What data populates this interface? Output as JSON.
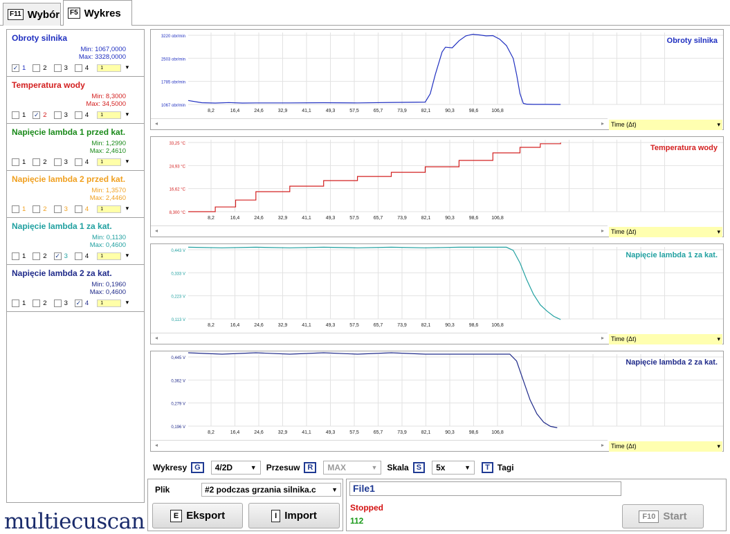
{
  "tabs": [
    {
      "key": "F11",
      "label": "Wybór",
      "active": false
    },
    {
      "key": "F5",
      "label": "Wykres",
      "active": true
    }
  ],
  "sensors": [
    {
      "name": "Obroty silnika",
      "min": "Min: 1067,0000",
      "max": "Max: 3328,0000",
      "color": "#1f2fc0",
      "checked": 1
    },
    {
      "name": "Temperatura wody",
      "min": "Min: 8,3000",
      "max": "Max: 34,5000",
      "color": "#d32020",
      "checked": 2
    },
    {
      "name": "Napięcie lambda 1 przed kat.",
      "min": "Min: 1,2990",
      "max": "Max: 2,4610",
      "color": "#1a8a1a",
      "checked": 0
    },
    {
      "name": "Napięcie lambda 2 przed kat.",
      "min": "Min: 1,3570",
      "max": "Max: 2,4460",
      "color": "#f0a020",
      "checked": 0
    },
    {
      "name": "Napięcie lambda 1 za kat.",
      "min": "Min: 0,1130",
      "max": "Max: 0,4600",
      "color": "#20a0a0",
      "checked": 3
    },
    {
      "name": "Napięcie lambda 2 za kat.",
      "min": "Min: 0,1960",
      "max": "Max: 0,4600",
      "color": "#1f2a8a",
      "checked": 4
    }
  ],
  "checkbox_labels": [
    "1",
    "2",
    "3",
    "4"
  ],
  "mini_select_value": "1",
  "logo": "multiecuscan",
  "time_selector": "Time (Δt)",
  "chart_data": [
    {
      "type": "line",
      "title": "Obroty silnika",
      "color": "#1f2fc0",
      "x_ticks": [
        "8,2",
        "16,4",
        "24,6",
        "32,9",
        "41,1",
        "49,3",
        "57,5",
        "65,7",
        "73,9",
        "82,1",
        "90,3",
        "98,6",
        "106,8"
      ],
      "y_ticks": [
        "3220 obr/min",
        "2503 obr/min",
        "1785 obr/min",
        "1067 obr/min"
      ],
      "y_tick_values": [
        3220,
        2503,
        1785,
        1067
      ],
      "ylim": [
        1067,
        3220
      ],
      "xlim": [
        0,
        158
      ],
      "x": [
        0,
        4,
        8,
        12,
        16,
        20,
        30,
        40,
        50,
        60,
        70,
        71.5,
        73,
        75,
        76,
        78,
        80,
        82,
        84,
        86,
        88,
        90,
        92,
        94,
        96,
        97,
        98,
        99,
        100,
        102,
        106,
        110
      ],
      "y": [
        1190,
        1120,
        1110,
        1125,
        1110,
        1115,
        1115,
        1120,
        1115,
        1130,
        1140,
        1400,
        2000,
        2700,
        2850,
        2830,
        3050,
        3200,
        3250,
        3230,
        3200,
        3210,
        3100,
        2900,
        2500,
        2000,
        1400,
        1100,
        1075,
        1070,
        1070,
        1067
      ]
    },
    {
      "type": "line",
      "title": "Temperatura wody",
      "color": "#d32020",
      "x_ticks": [
        "8,2",
        "16,4",
        "24,6",
        "32,9",
        "41,1",
        "49,3",
        "57,5",
        "65,7",
        "73,9",
        "82,1",
        "90,3",
        "98,6",
        "106,8"
      ],
      "y_ticks": [
        "33,25 °C",
        "24,93 °C",
        "16,62 °C",
        "8,300 °C"
      ],
      "y_tick_values": [
        33.25,
        24.93,
        16.62,
        8.3
      ],
      "ylim": [
        8.3,
        33.25
      ],
      "xlim": [
        0,
        158
      ],
      "x": [
        0,
        6,
        8,
        14,
        20,
        30,
        40,
        50,
        60,
        70,
        80,
        90,
        98,
        104,
        110
      ],
      "y": [
        8.3,
        8.3,
        10,
        12.5,
        15.5,
        17.5,
        19.5,
        21,
        22.5,
        24.5,
        26.8,
        29.5,
        31.5,
        32.8,
        33.2
      ]
    },
    {
      "type": "line",
      "title": "Napięcie lambda 1 za kat.",
      "color": "#20a0a0",
      "x_ticks": [
        "8,2",
        "16,4",
        "24,6",
        "32,9",
        "41,1",
        "49,3",
        "57,5",
        "65,7",
        "73,9",
        "82,1",
        "90,3",
        "98,6",
        "106,8"
      ],
      "y_ticks": [
        "0,443 V",
        "0,333 V",
        "0,223 V",
        "0,113 V"
      ],
      "y_tick_values": [
        0.443,
        0.333,
        0.223,
        0.113
      ],
      "ylim": [
        0.113,
        0.443
      ],
      "xlim": [
        0,
        158
      ],
      "x": [
        0,
        10,
        20,
        30,
        40,
        50,
        60,
        70,
        80,
        90,
        94,
        96,
        98,
        100,
        102,
        104,
        106,
        108,
        110
      ],
      "y": [
        0.455,
        0.452,
        0.455,
        0.452,
        0.455,
        0.452,
        0.455,
        0.452,
        0.455,
        0.455,
        0.455,
        0.44,
        0.38,
        0.3,
        0.23,
        0.18,
        0.15,
        0.125,
        0.11
      ]
    },
    {
      "type": "line",
      "title": "Napięcie lambda 2 za kat.",
      "color": "#1f2a8a",
      "x_ticks": [
        "8,2",
        "16,4",
        "24,6",
        "32,9",
        "41,1",
        "49,3",
        "57,5",
        "65,7",
        "73,9",
        "82,1",
        "90,3",
        "98,6",
        "106,8"
      ],
      "y_ticks": [
        "0,445 V",
        "0,362 V",
        "0,279 V",
        "0,196 V"
      ],
      "y_tick_values": [
        0.445,
        0.362,
        0.279,
        0.196
      ],
      "ylim": [
        0.196,
        0.445
      ],
      "xlim": [
        0,
        158
      ],
      "x": [
        0,
        10,
        20,
        30,
        40,
        50,
        60,
        70,
        80,
        90,
        95,
        97,
        99,
        101,
        103,
        105,
        107,
        109
      ],
      "y": [
        0.46,
        0.455,
        0.46,
        0.455,
        0.46,
        0.455,
        0.46,
        0.455,
        0.455,
        0.455,
        0.455,
        0.43,
        0.36,
        0.29,
        0.24,
        0.21,
        0.195,
        0.19
      ]
    }
  ],
  "controls": {
    "wykresy_label": "Wykresy",
    "wykresy_key": "G",
    "wykresy_value": "4/2D",
    "przesuw_label": "Przesuw",
    "przesuw_key": "R",
    "przesuw_value": "MAX",
    "skala_label": "Skala",
    "skala_key": "S",
    "skala_value": "5x",
    "tagi_key": "T",
    "tagi_label": "Tagi"
  },
  "file_panel": {
    "plik_label": "Plik",
    "file_select": "#2 podczas grzania silnika.c",
    "export_key": "E",
    "export_label": "Eksport",
    "import_key": "I",
    "import_label": "Import"
  },
  "status_panel": {
    "file_name": "File1",
    "status": "Stopped",
    "count": "112",
    "start_key": "F10",
    "start_label": "Start"
  }
}
